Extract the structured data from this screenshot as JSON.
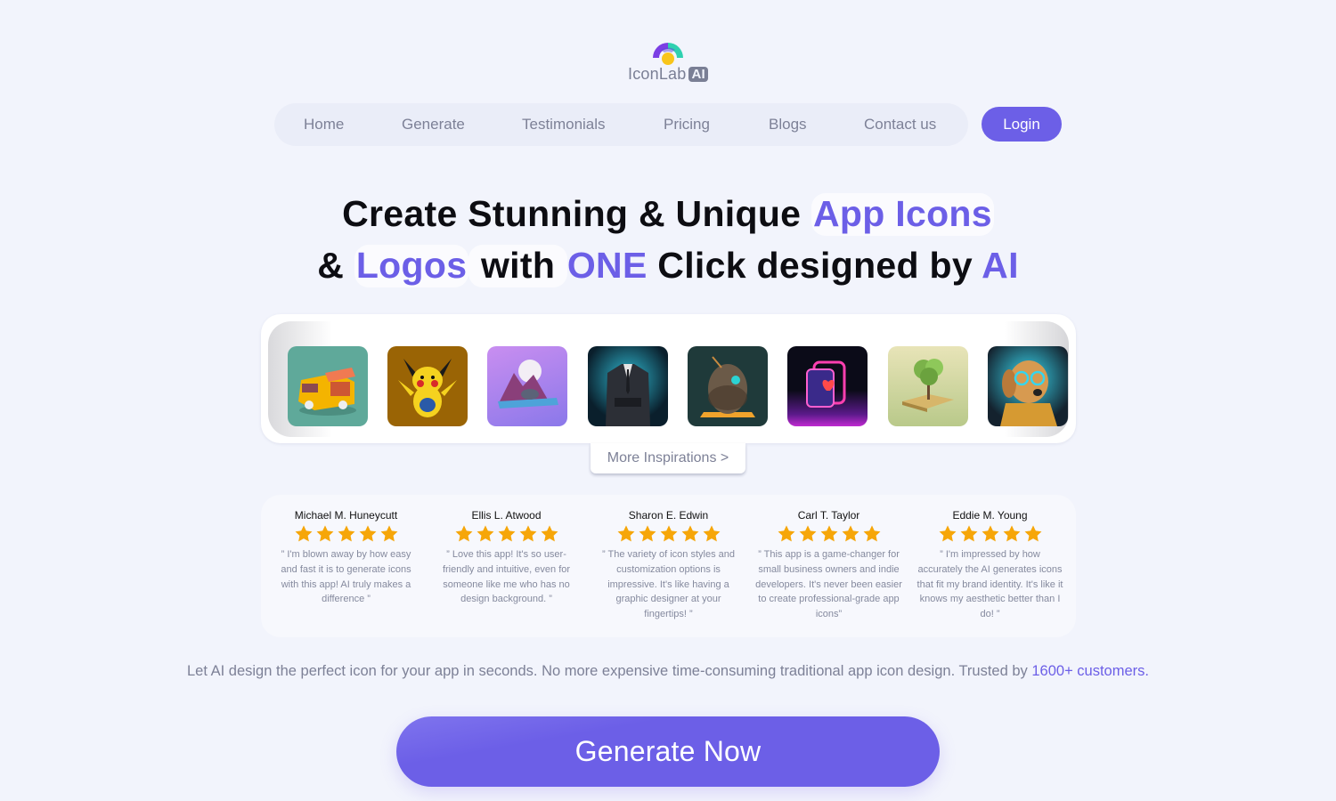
{
  "brand": {
    "name": "IconLab",
    "badge": "AI",
    "colors": {
      "accent": "#6c5fe7",
      "logo_purple": "#7b3fe4",
      "logo_teal": "#2fd1b0",
      "logo_sun": "#f8c51b",
      "star": "#f6a609"
    }
  },
  "nav": {
    "items": [
      {
        "label": "Home"
      },
      {
        "label": "Generate"
      },
      {
        "label": "Testimonials"
      },
      {
        "label": "Pricing"
      },
      {
        "label": "Blogs"
      },
      {
        "label": "Contact us"
      }
    ],
    "login_label": "Login"
  },
  "hero": {
    "line1": {
      "plain": "Create Stunning & Unique ",
      "highlight": "App Icons"
    },
    "line2": {
      "amp": "& ",
      "logos": "Logos",
      "with": " with ",
      "one": "ONE",
      "click": " Click designed by ",
      "ai": "AI"
    }
  },
  "gallery": {
    "tiles": [
      {
        "icon": "food-truck-icon",
        "label": "Food truck"
      },
      {
        "icon": "pikachu-icon",
        "label": "Yellow creature"
      },
      {
        "icon": "elephant-landscape-icon",
        "label": "Elephant landscape"
      },
      {
        "icon": "suit-icon",
        "label": "Business suit"
      },
      {
        "icon": "egg-icon",
        "label": "Stone egg"
      },
      {
        "icon": "neon-cards-icon",
        "label": "Neon cards"
      },
      {
        "icon": "bonsai-tree-icon",
        "label": "Tree on block"
      },
      {
        "icon": "dog-glasses-icon",
        "label": "Dog with glasses"
      }
    ],
    "more_label": "More Inspirations >"
  },
  "testimonials": [
    {
      "name": "Michael M. Huneycutt",
      "rating": 5,
      "text": "” I'm blown away by how easy and fast it is to generate icons with this app! AI truly makes a difference ”"
    },
    {
      "name": "Ellis L. Atwood",
      "rating": 5,
      "text": "” Love this app! It's so user-friendly and intuitive, even for someone like me who has no design background. ”"
    },
    {
      "name": "Sharon E. Edwin",
      "rating": 5,
      "text": "” The variety of icon styles and customization options is impressive. It's like having a graphic designer at your fingertips! ”"
    },
    {
      "name": "Carl T. Taylor",
      "rating": 5,
      "text": "” This app is a game-changer for small business owners and indie developers. It's never been easier to create professional-grade app icons”"
    },
    {
      "name": "Eddie M. Young",
      "rating": 5,
      "text": "” I'm impressed by how accurately the AI generates icons that fit my brand identity. It's like it knows my aesthetic better than I do! ”"
    }
  ],
  "tagline": {
    "text": "Let AI design the perfect icon for your app in seconds. No more expensive time-consuming traditional app icon design. Trusted by ",
    "accent": "1600+ customers."
  },
  "cta": {
    "label": "Generate Now"
  }
}
